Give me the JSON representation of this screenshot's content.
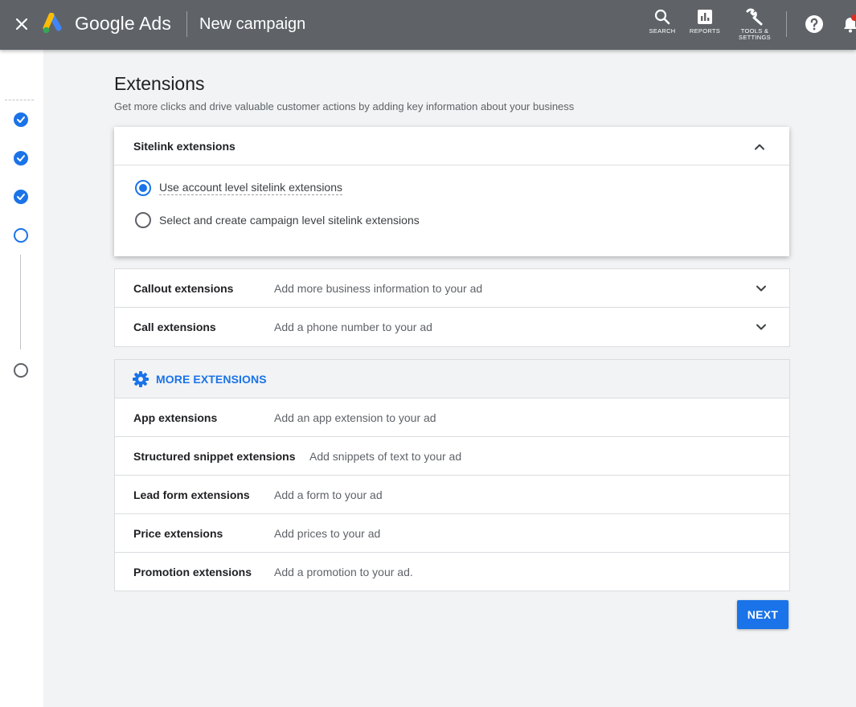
{
  "header": {
    "brand": "Google Ads",
    "campaign_title": "New campaign",
    "tools": {
      "search_label": "SEARCH",
      "reports_label": "REPORTS",
      "tools_label_line1": "TOOLS &",
      "tools_label_line2": "SETTINGS"
    }
  },
  "stepper": {
    "steps": [
      "done",
      "done",
      "done",
      "current",
      "todo"
    ]
  },
  "page": {
    "title": "Extensions",
    "subtitle": "Get more clicks and drive valuable customer actions by adding key information about your business"
  },
  "sitelink": {
    "title": "Sitelink extensions",
    "options": [
      {
        "label": "Use account level sitelink extensions",
        "selected": true
      },
      {
        "label": "Select and create campaign level sitelink extensions",
        "selected": false
      }
    ]
  },
  "extensions": [
    {
      "name": "Callout extensions",
      "desc": "Add more business information to your ad"
    },
    {
      "name": "Call extensions",
      "desc": "Add a phone number to your ad"
    }
  ],
  "more": {
    "label": "MORE EXTENSIONS",
    "items": [
      {
        "name": "App extensions",
        "desc": "Add an app extension to your ad"
      },
      {
        "name": "Structured snippet extensions",
        "desc": "Add snippets of text to your ad"
      },
      {
        "name": "Lead form extensions",
        "desc": "Add a form to your ad"
      },
      {
        "name": "Price extensions",
        "desc": "Add prices to your ad"
      },
      {
        "name": "Promotion extensions",
        "desc": "Add a promotion to your ad."
      }
    ]
  },
  "actions": {
    "next_label": "NEXT"
  },
  "colors": {
    "topbar": "#5f6368",
    "accent": "#1a73e8"
  }
}
